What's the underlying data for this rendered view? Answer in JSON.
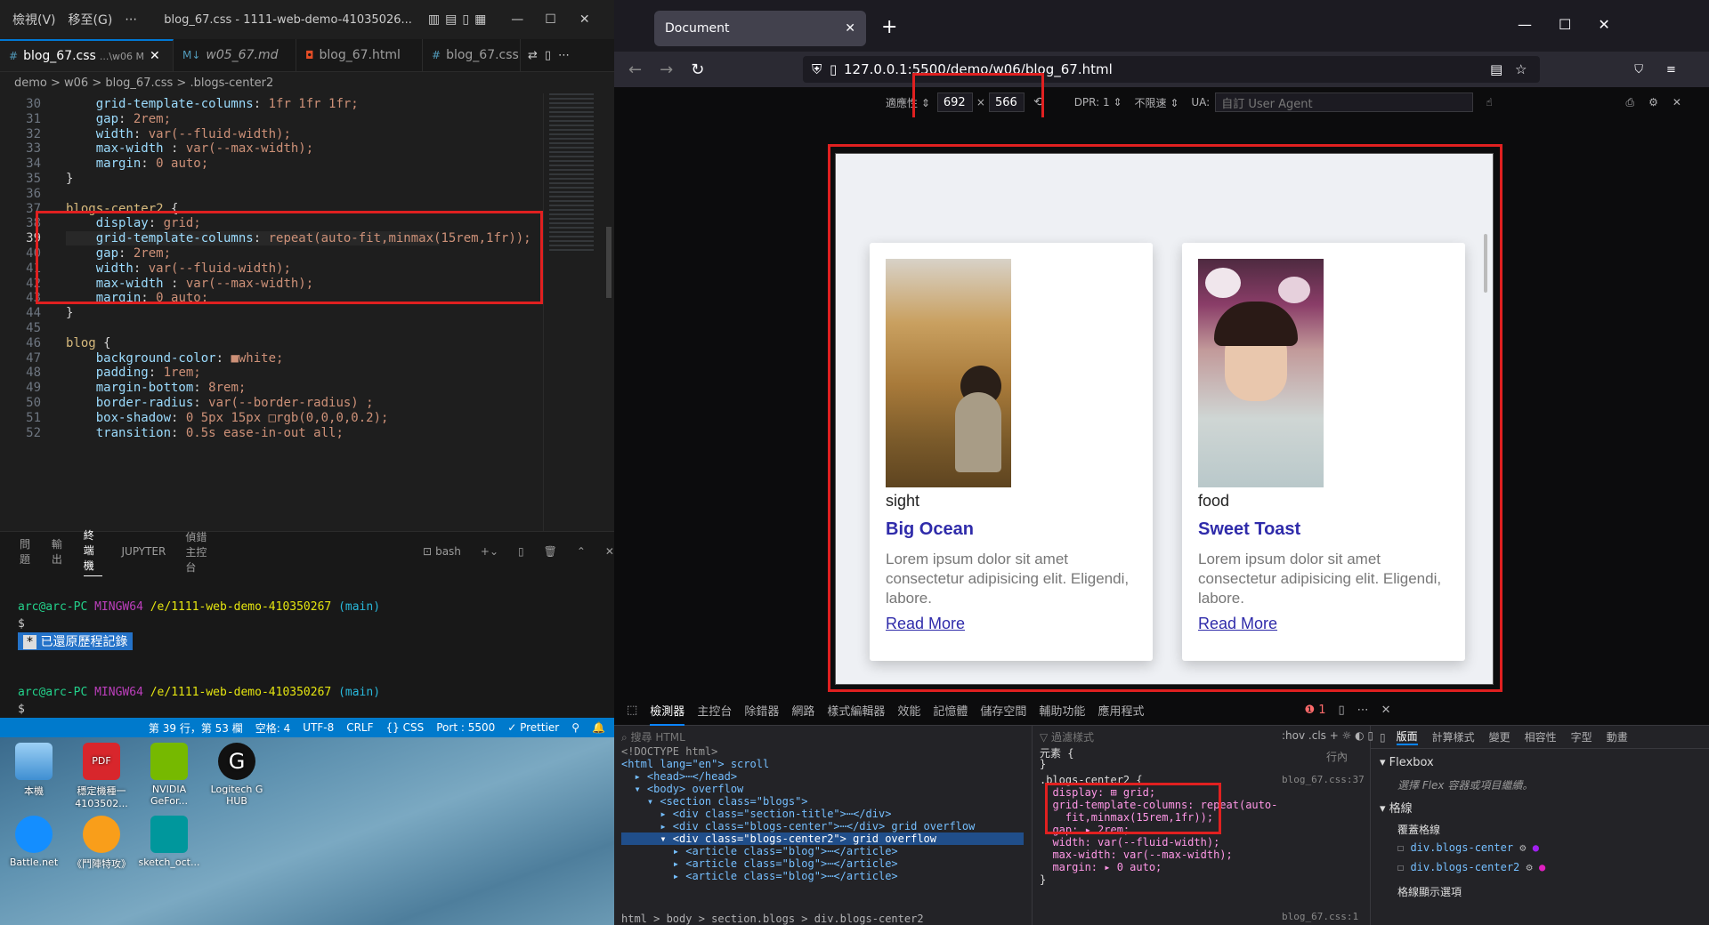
{
  "vscode": {
    "title_menu": [
      "檢視(V)",
      "移至(G)",
      "⋯",
      "blog_67.css - 1111-web-demo-41035026..."
    ],
    "tabs": [
      {
        "label": "blog_67.css",
        "detail": "...\\w06 M",
        "active": true
      },
      {
        "label": "w05_67.md"
      },
      {
        "label": "blog_67.html"
      },
      {
        "label": "blog_67.css ..."
      }
    ],
    "breadcrumb": "demo  >  w06  >  blog_67.css  >  .blogs-center2",
    "lines": [
      {
        "n": "30",
        "t": "    grid-template-columns: 1fr 1fr 1fr;"
      },
      {
        "n": "31",
        "t": "    gap: 2rem;"
      },
      {
        "n": "32",
        "t": "    width: var(--fluid-width);"
      },
      {
        "n": "33",
        "t": "    max-width : var(--max-width);"
      },
      {
        "n": "34",
        "t": "    margin: 0 auto;"
      },
      {
        "n": "35",
        "t": "}"
      },
      {
        "n": "36",
        "t": ""
      },
      {
        "n": "37",
        "t": "blogs-center2 {"
      },
      {
        "n": "38",
        "t": "    display: grid;"
      },
      {
        "n": "39",
        "t": "    grid-template-columns: repeat(auto-fit,minmax(15rem,1fr));"
      },
      {
        "n": "40",
        "t": "    gap: 2rem;"
      },
      {
        "n": "41",
        "t": "    width: var(--fluid-width);"
      },
      {
        "n": "42",
        "t": "    max-width : var(--max-width);"
      },
      {
        "n": "43",
        "t": "    margin: 0 auto;"
      },
      {
        "n": "44",
        "t": "}"
      },
      {
        "n": "45",
        "t": ""
      },
      {
        "n": "46",
        "t": "blog {"
      },
      {
        "n": "47",
        "t": "    background-color: ■white;"
      },
      {
        "n": "48",
        "t": "    padding: 1rem;"
      },
      {
        "n": "49",
        "t": "    margin-bottom: 8rem;"
      },
      {
        "n": "50",
        "t": "    border-radius: var(--border-radius) ;"
      },
      {
        "n": "51",
        "t": "    box-shadow: 0 5px 15px □rgb(0,0,0,0.2);"
      },
      {
        "n": "52",
        "t": "    transition: 0.5s ease-in-out all;"
      }
    ],
    "panel_tabs": [
      "問題",
      "輸出",
      "終端機",
      "JUPYTER",
      "偵錯主控台"
    ],
    "panel_active": "終端機",
    "terminal_shell": "bash",
    "prompt1_user": "arc@arc-PC",
    "prompt1_env": "MINGW64",
    "prompt1_path": "/e/1111-web-demo-410350267",
    "prompt1_branch": "(main)",
    "dollar": "$",
    "restored": "已還原歷程記錄",
    "status": [
      "第 39 行，第 53 欄",
      "空格: 4",
      "UTF-8",
      "CRLF",
      "{} CSS",
      "Port : 5500",
      "✓ Prettier"
    ]
  },
  "desktop": {
    "icons": [
      "本機",
      "穩定機種一 4103502...",
      "NVIDIA GeFor...",
      "Logitech G HUB",
      "Battle.net",
      "《鬥陣特攻》",
      "sketch_oct..."
    ]
  },
  "browser": {
    "tab_title": "Document",
    "url": "127.0.0.1:5500/demo/w06/blog_67.html",
    "rdm": {
      "label": "適應性",
      "width": "692",
      "height": "566",
      "dpr": "DPR: 1",
      "throttle": "不限速",
      "ua_label": "UA:",
      "ua_placeholder": "自訂 User Agent"
    },
    "cards": [
      {
        "tag": "sight",
        "title": "Big Ocean",
        "text": "Lorem ipsum dolor sit amet consectetur adipisicing elit. Eligendi, labore.",
        "link": "Read More"
      },
      {
        "tag": "food",
        "title": "Sweet Toast",
        "text": "Lorem ipsum dolor sit amet consectetur adipisicing elit. Eligendi, labore.",
        "link": "Read More"
      }
    ],
    "devtools": {
      "tabs": [
        "檢測器",
        "主控台",
        "除錯器",
        "網路",
        "樣式編輯器",
        "效能",
        "記憶體",
        "儲存空間",
        "輔助功能",
        "應用程式"
      ],
      "search_placeholder": "搜尋 HTML",
      "html_lines": [
        "<!DOCTYPE html>",
        "<html lang=\"en\"> scroll",
        "  ▸ <head>⋯</head>",
        "  ▾ <body> overflow",
        "    ▾ <section class=\"blogs\">",
        "      ▸ <div class=\"section-title\">⋯</div>",
        "      ▸ <div class=\"blogs-center\">⋯</div> grid overflow",
        "      ▾ <div class=\"blogs-center2\"> grid overflow",
        "        ▸ <article class=\"blog\">⋯</article>",
        "        ▸ <article class=\"blog\">⋯</article>",
        "        ▸ <article class=\"blog\">⋯</article>"
      ],
      "html_breadcrumb": "html > body > section.blogs > div.blogs-center2",
      "filter_placeholder": "過濾樣式",
      "css_lines": [
        "元素 {",
        "}",
        ".blogs-center2 {",
        "  display: ⊞ grid;",
        "  grid-template-columns: repeat(auto-",
        "    fit,minmax(15rem,1fr));",
        "  gap: ▸ 2rem;",
        "  width: var(--fluid-width);",
        "  max-width: var(--max-width);",
        "  margin: ▸ 0 auto;",
        "}"
      ],
      "css_source": "blog_67.css:37",
      "css_source2": "blog_67.css:1",
      "inline_label": "行內",
      "layout_tabs": [
        "版面",
        "計算樣式",
        "變更",
        "相容性",
        "字型",
        "動畫"
      ],
      "flexbox": "Flexbox",
      "flex_hint": "選擇 Flex 容器或項目繼續。",
      "grid": "格線",
      "overlay": "覆蓋格線",
      "grids": [
        "div.blogs-center",
        "div.blogs-center2"
      ],
      "grid_display": "格線顯示選項"
    }
  }
}
